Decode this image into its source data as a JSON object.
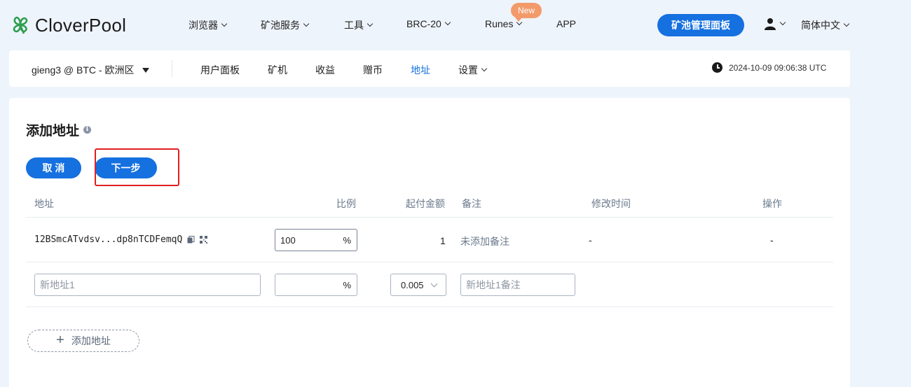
{
  "brand": {
    "name": "CloverPool",
    "accent": "#1570e0",
    "logo_color": "#2e9e4f"
  },
  "nav": {
    "items": [
      {
        "label": "浏览器",
        "dropdown": true
      },
      {
        "label": "矿池服务",
        "dropdown": true
      },
      {
        "label": "工具",
        "dropdown": true
      },
      {
        "label": "BRC-20",
        "dropdown": true
      },
      {
        "label": "Runes",
        "dropdown": true,
        "badge": "New"
      },
      {
        "label": "APP",
        "dropdown": false
      }
    ],
    "dashboard_button": "矿池管理面板",
    "user_icon": "user-icon",
    "language": "简体中文"
  },
  "subbar": {
    "account": "gieng3 @ BTC - 欧洲区",
    "tabs": [
      {
        "label": "用户面板",
        "active": false
      },
      {
        "label": "矿机",
        "active": false
      },
      {
        "label": "收益",
        "active": false
      },
      {
        "label": "赠币",
        "active": false
      },
      {
        "label": "地址",
        "active": true
      },
      {
        "label": "设置",
        "active": false,
        "dropdown": true
      }
    ],
    "datetime": "2024-10-09 09:06:38 UTC"
  },
  "page": {
    "title": "添加地址",
    "info_icon": "info-icon",
    "cancel_label": "取 消",
    "next_label": "下一步",
    "highlight_color": "#e02020"
  },
  "table": {
    "headers": [
      "地址",
      "比例",
      "起付金额",
      "备注",
      "修改时间",
      "操作"
    ],
    "rows": [
      {
        "address": "12BSmcATvdsv...dp8nTCDFemqQ",
        "ratio": "100",
        "ratio_unit": "%",
        "min_payment": "1",
        "note": "未添加备注",
        "modified": "-",
        "action": "-"
      }
    ],
    "new_row": {
      "address_placeholder": "新地址1",
      "ratio_value": "",
      "ratio_unit": "%",
      "min_payment": "0.005",
      "note_placeholder": "新地址1备注"
    },
    "add_address_label": "添加地址"
  }
}
